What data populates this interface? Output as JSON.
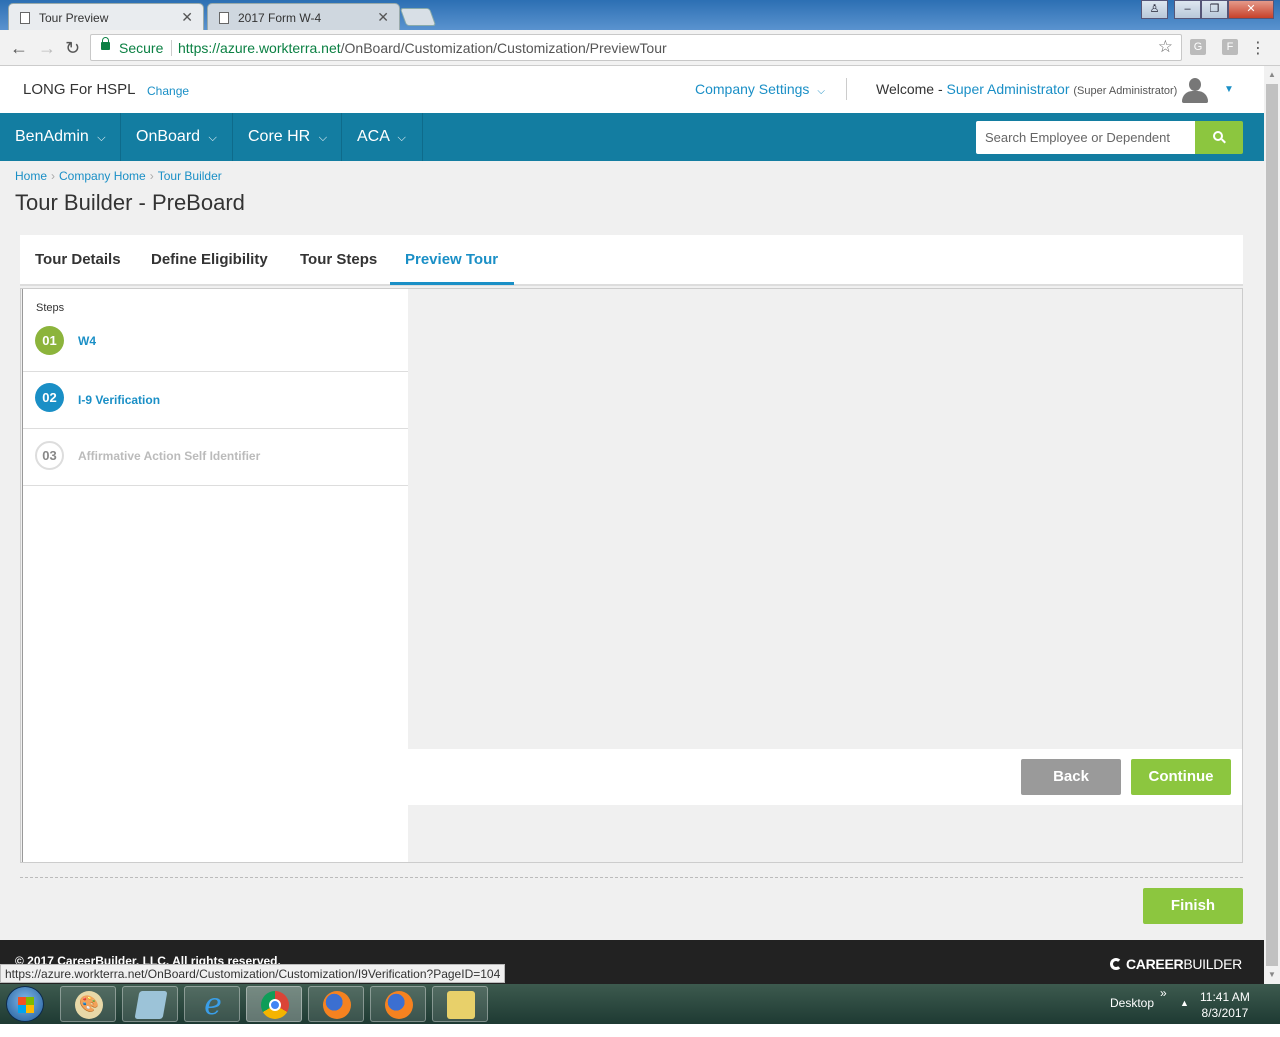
{
  "browser": {
    "tabs": [
      {
        "title": "Tour Preview",
        "active": true
      },
      {
        "title": "2017 Form W-4",
        "active": false
      }
    ],
    "secure_label": "Secure",
    "url_scheme": "https://",
    "url_host": "azure.workterra.net",
    "url_path": "/OnBoard/Customization/Customization/PreviewTour",
    "status_url": "https://azure.workterra.net/OnBoard/Customization/Customization/I9Verification?PageID=104"
  },
  "header": {
    "company_name": "LONG For HSPL",
    "change_label": "Change",
    "company_settings_label": "Company Settings",
    "welcome_prefix": "Welcome -",
    "user_name": "Super Administrator",
    "user_role": "(Super Administrator)"
  },
  "nav": {
    "items": [
      "BenAdmin",
      "OnBoard",
      "Core HR",
      "ACA"
    ],
    "search_placeholder": "Search Employee or Dependent"
  },
  "breadcrumb": [
    "Home",
    "Company Home",
    "Tour Builder"
  ],
  "page_title": "Tour Builder - PreBoard",
  "tabs": [
    {
      "label": "Tour Details",
      "active": false
    },
    {
      "label": "Define Eligibility",
      "active": false
    },
    {
      "label": "Tour Steps",
      "active": false
    },
    {
      "label": "Preview Tour",
      "active": true
    }
  ],
  "steps_heading": "Steps",
  "steps": [
    {
      "number": "01",
      "label": "W4",
      "state": "completed",
      "color": "#8cb43c"
    },
    {
      "number": "02",
      "label": "I-9 Verification",
      "state": "current",
      "color": "#1a8fc6"
    },
    {
      "number": "03",
      "label": "Affirmative Action Self Identifier",
      "state": "disabled",
      "color": "#d9d9d9"
    }
  ],
  "buttons": {
    "back": "Back",
    "continue": "Continue",
    "finish": "Finish"
  },
  "footer": {
    "copyright": "© 2017 CareerBuilder, LLC. All rights reserved.",
    "logo_bold": "CAREER",
    "logo_light": "BUILDER"
  },
  "taskbar": {
    "desktop_label": "Desktop",
    "time": "11:41 AM",
    "date": "8/3/2017"
  },
  "colors": {
    "brand_teal": "#137da1",
    "link_blue": "#1a8fc6",
    "accent_green": "#8cc63f",
    "back_gray": "#9a9a9a"
  }
}
